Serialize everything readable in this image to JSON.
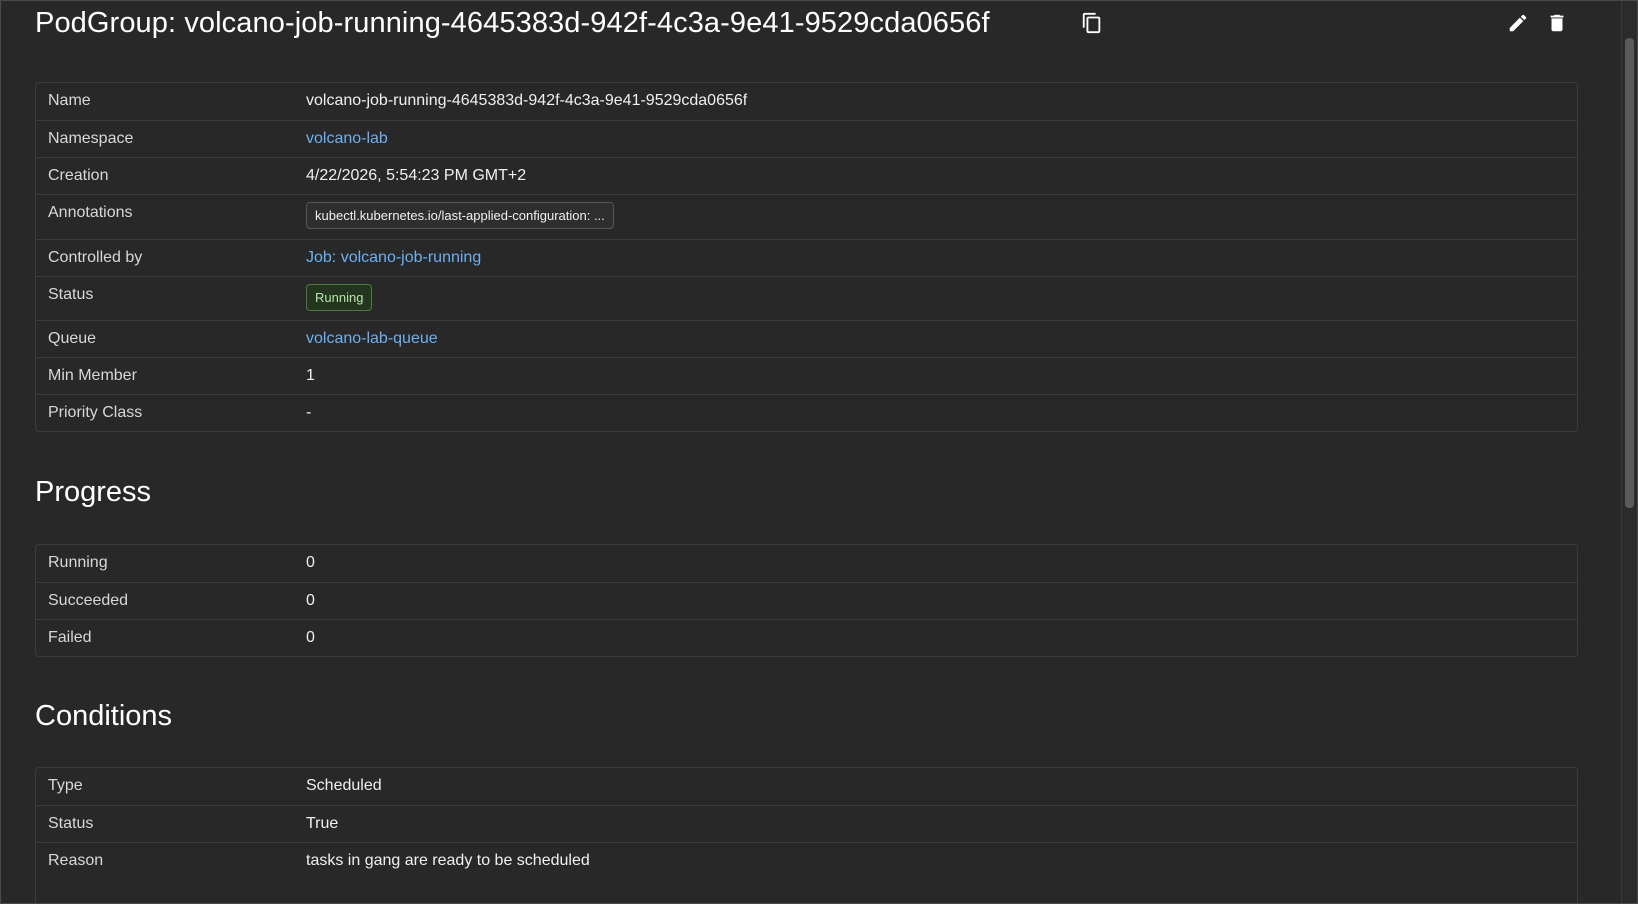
{
  "header": {
    "title": "PodGroup: volcano-job-running-4645383d-942f-4c3a-9e41-9529cda0656f"
  },
  "details": {
    "rows": {
      "name": {
        "label": "Name",
        "value": "volcano-job-running-4645383d-942f-4c3a-9e41-9529cda0656f"
      },
      "namespace": {
        "label": "Namespace",
        "value": "volcano-lab"
      },
      "creation": {
        "label": "Creation",
        "value": "4/22/2026, 5:54:23 PM GMT+2"
      },
      "annotations": {
        "label": "Annotations",
        "value": "kubectl.kubernetes.io/last-applied-configuration: ..."
      },
      "controlled_by": {
        "label": "Controlled by",
        "value": "Job: volcano-job-running"
      },
      "status": {
        "label": "Status",
        "value": "Running"
      },
      "queue": {
        "label": "Queue",
        "value": "volcano-lab-queue"
      },
      "min_member": {
        "label": "Min Member",
        "value": "1"
      },
      "priority_class": {
        "label": "Priority Class",
        "value": "-"
      }
    }
  },
  "progress": {
    "title": "Progress",
    "rows": {
      "running": {
        "label": "Running",
        "value": "0"
      },
      "succeeded": {
        "label": "Succeeded",
        "value": "0"
      },
      "failed": {
        "label": "Failed",
        "value": "0"
      }
    }
  },
  "conditions": {
    "title": "Conditions",
    "rows": {
      "type": {
        "label": "Type",
        "value": "Scheduled"
      },
      "status": {
        "label": "Status",
        "value": "True"
      },
      "reason": {
        "label": "Reason",
        "value": "tasks in gang are ready to be scheduled"
      }
    }
  },
  "colors": {
    "background": "#282828",
    "link": "#6ab0f3",
    "status_running": "#b8e3a8"
  },
  "icons": [
    "copy-icon",
    "pencil-icon",
    "trash-icon"
  ]
}
